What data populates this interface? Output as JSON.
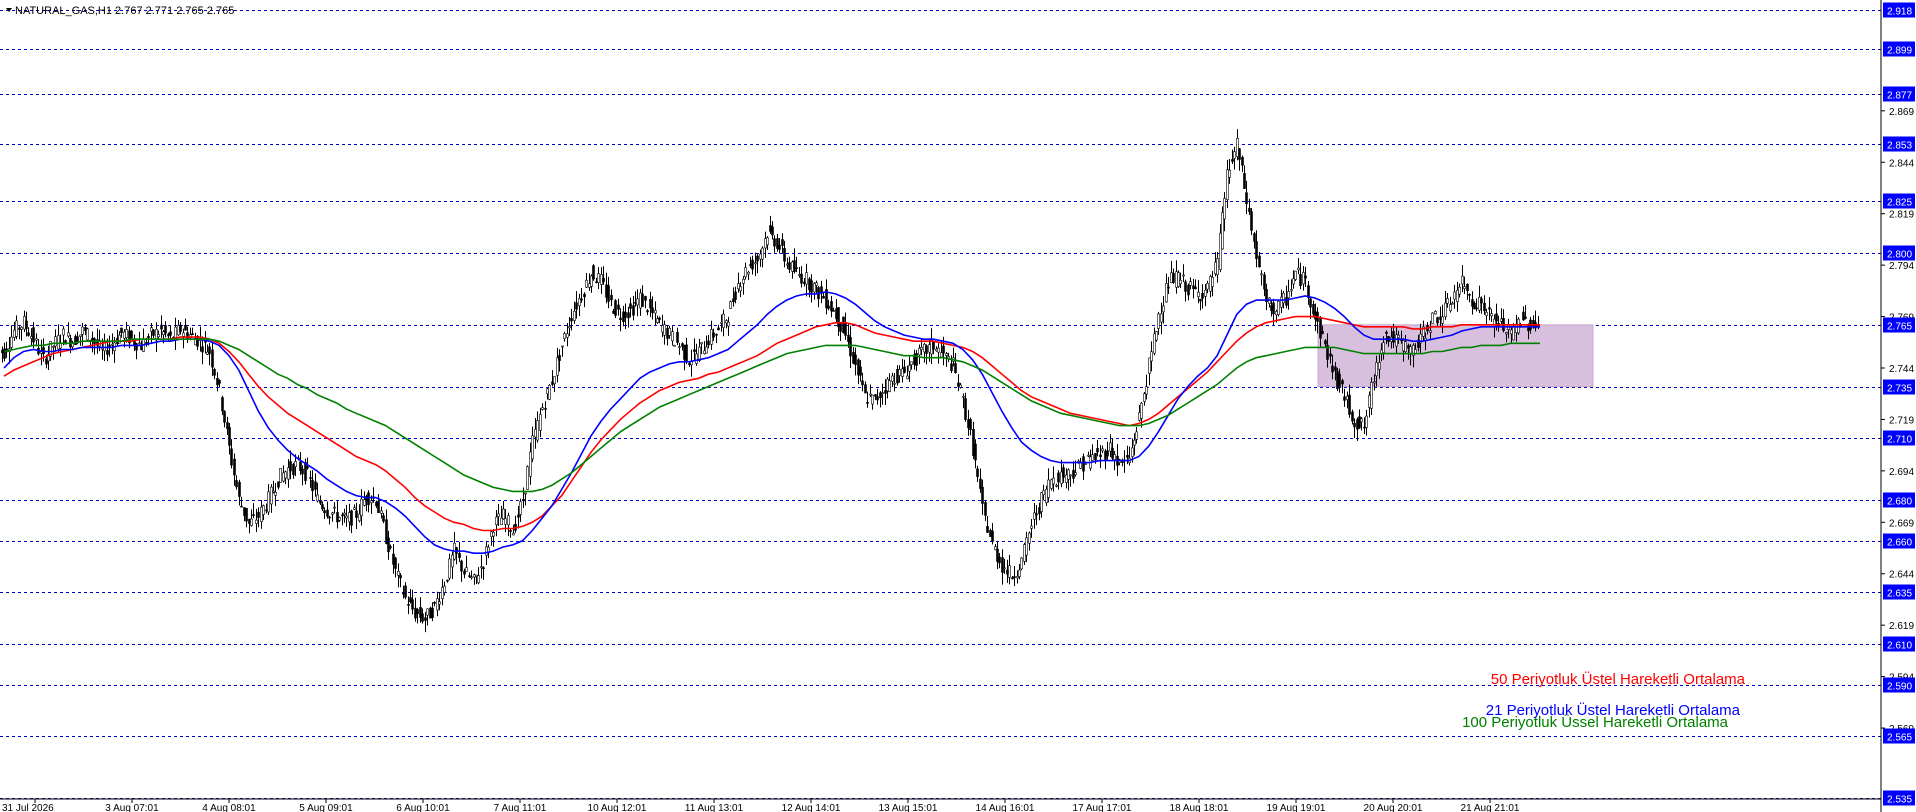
{
  "symbol_line": "NATURAL_GAS,H1  2.767 2.771 2.765 2.765",
  "legend": [
    {
      "text": "50 Periyotluk Üstel Hareketli Ortalama",
      "color": "#ff0000"
    },
    {
      "text": "21 Periyotluk Üstel Hareketli Ortalama",
      "color": "#0000ff"
    },
    {
      "text": "100 Periyotluk Üssel Hareketli Ortalama",
      "color": "#008000"
    }
  ],
  "colors": {
    "grid_line": "#0000cc",
    "candle": "#000000",
    "zone": "#d8bfdd",
    "label_bg": "#0000ff"
  },
  "chart_data": {
    "type": "line",
    "title": "NATURAL_GAS,H1",
    "ylim": [
      2.535,
      2.918
    ],
    "y_ticks": [
      "2.869",
      "2.844",
      "2.819",
      "2.794",
      "2.769",
      "2.744",
      "2.719",
      "2.694",
      "2.669",
      "2.644",
      "2.619",
      "2.594",
      "2.569"
    ],
    "horizontal_levels": [
      "2.918",
      "2.899",
      "2.877",
      "2.853",
      "2.825",
      "2.800",
      "2.765",
      "2.735",
      "2.710",
      "2.680",
      "2.660",
      "2.635",
      "2.610",
      "2.590",
      "2.565",
      "2.535"
    ],
    "x_labels": [
      "31 Jul 2026",
      "3 Aug 07:01",
      "4 Aug 08:01",
      "5 Aug 09:01",
      "6 Aug 10:01",
      "7 Aug 11:01",
      "10 Aug 12:01",
      "11 Aug 13:01",
      "12 Aug 14:01",
      "13 Aug 15:01",
      "14 Aug 16:01",
      "17 Aug 17:01",
      "18 Aug 18:01",
      "19 Aug 19:01",
      "20 Aug 20:01",
      "21 Aug 21:01"
    ],
    "zone": {
      "from_label": "20 Aug 20:01",
      "to_label": "21 Aug 21:01",
      "top": 2.765,
      "bottom": 2.735
    },
    "price": [
      2.752,
      2.762,
      2.766,
      2.758,
      2.748,
      2.755,
      2.76,
      2.757,
      2.762,
      2.758,
      2.752,
      2.756,
      2.761,
      2.758,
      2.755,
      2.76,
      2.762,
      2.758,
      2.763,
      2.76,
      2.757,
      2.752,
      2.733,
      2.705,
      2.68,
      2.668,
      2.672,
      2.68,
      2.69,
      2.695,
      2.697,
      2.692,
      2.68,
      2.675,
      2.672,
      2.67,
      2.673,
      2.682,
      2.68,
      2.662,
      2.645,
      2.632,
      2.625,
      2.622,
      2.628,
      2.64,
      2.655,
      2.645,
      2.64,
      2.65,
      2.668,
      2.672,
      2.665,
      2.68,
      2.708,
      2.725,
      2.738,
      2.755,
      2.77,
      2.78,
      2.79,
      2.786,
      2.775,
      2.77,
      2.772,
      2.778,
      2.772,
      2.765,
      2.76,
      2.755,
      2.748,
      2.752,
      2.758,
      2.763,
      2.77,
      2.785,
      2.793,
      2.797,
      2.81,
      2.805,
      2.795,
      2.79,
      2.787,
      2.782,
      2.777,
      2.77,
      2.76,
      2.745,
      2.73,
      2.728,
      2.735,
      2.74,
      2.742,
      2.748,
      2.752,
      2.755,
      2.75,
      2.745,
      2.728,
      2.705,
      2.675,
      2.658,
      2.648,
      2.643,
      2.65,
      2.668,
      2.68,
      2.69,
      2.692,
      2.693,
      2.697,
      2.7,
      2.702,
      2.705,
      2.697,
      2.7,
      2.72,
      2.745,
      2.77,
      2.786,
      2.788,
      2.783,
      2.78,
      2.782,
      2.795,
      2.838,
      2.852,
      2.825,
      2.798,
      2.775,
      2.772,
      2.778,
      2.79,
      2.786,
      2.768,
      2.755,
      2.74,
      2.73,
      2.718,
      2.715,
      2.74,
      2.76,
      2.758,
      2.755,
      2.752,
      2.76,
      2.768,
      2.77,
      2.778,
      2.785,
      2.777,
      2.775,
      2.768,
      2.765,
      2.76,
      2.768,
      2.765,
      2.765
    ],
    "series": [
      {
        "name": "50 Periyotluk Üstel Hareketli Ortalama",
        "color": "#ff0000",
        "values": [
          2.74,
          2.743,
          2.745,
          2.747,
          2.749,
          2.751,
          2.752,
          2.753,
          2.754,
          2.755,
          2.756,
          2.757,
          2.757,
          2.757,
          2.758,
          2.758,
          2.758,
          2.758,
          2.759,
          2.759,
          2.759,
          2.758,
          2.756,
          2.752,
          2.747,
          2.741,
          2.735,
          2.73,
          2.726,
          2.722,
          2.719,
          2.716,
          2.713,
          2.71,
          2.707,
          2.704,
          2.701,
          2.699,
          2.697,
          2.694,
          2.69,
          2.686,
          2.681,
          2.677,
          2.674,
          2.671,
          2.669,
          2.668,
          2.666,
          2.665,
          2.665,
          2.666,
          2.666,
          2.667,
          2.669,
          2.672,
          2.677,
          2.682,
          2.689,
          2.696,
          2.703,
          2.709,
          2.714,
          2.719,
          2.723,
          2.727,
          2.73,
          2.733,
          2.735,
          2.737,
          2.738,
          2.739,
          2.741,
          2.742,
          2.744,
          2.746,
          2.748,
          2.75,
          2.753,
          2.756,
          2.758,
          2.76,
          2.762,
          2.764,
          2.765,
          2.766,
          2.766,
          2.765,
          2.763,
          2.761,
          2.76,
          2.759,
          2.758,
          2.757,
          2.757,
          2.757,
          2.756,
          2.755,
          2.754,
          2.752,
          2.749,
          2.745,
          2.741,
          2.737,
          2.733,
          2.73,
          2.728,
          2.726,
          2.724,
          2.722,
          2.721,
          2.72,
          2.719,
          2.718,
          2.717,
          2.716,
          2.717,
          2.719,
          2.722,
          2.726,
          2.73,
          2.734,
          2.738,
          2.742,
          2.747,
          2.752,
          2.757,
          2.761,
          2.764,
          2.766,
          2.767,
          2.768,
          2.769,
          2.769,
          2.769,
          2.768,
          2.767,
          2.766,
          2.765,
          2.764,
          2.764,
          2.764,
          2.764,
          2.764,
          2.763,
          2.763,
          2.764,
          2.764,
          2.764,
          2.765,
          2.765,
          2.765,
          2.765,
          2.765,
          2.765,
          2.765,
          2.765,
          2.765
        ]
      },
      {
        "name": "21 Periyotluk Üstel Hareketli Ortalama",
        "color": "#0000ff",
        "values": [
          2.744,
          2.749,
          2.752,
          2.753,
          2.752,
          2.752,
          2.753,
          2.753,
          2.754,
          2.754,
          2.754,
          2.754,
          2.755,
          2.755,
          2.755,
          2.756,
          2.757,
          2.757,
          2.758,
          2.758,
          2.758,
          2.757,
          2.755,
          2.75,
          2.743,
          2.733,
          2.723,
          2.715,
          2.709,
          2.704,
          2.7,
          2.697,
          2.694,
          2.69,
          2.687,
          2.684,
          2.682,
          2.681,
          2.681,
          2.679,
          2.676,
          2.672,
          2.667,
          2.662,
          2.658,
          2.656,
          2.655,
          2.655,
          2.654,
          2.654,
          2.655,
          2.657,
          2.658,
          2.66,
          2.665,
          2.671,
          2.677,
          2.685,
          2.693,
          2.702,
          2.711,
          2.718,
          2.724,
          2.729,
          2.734,
          2.739,
          2.742,
          2.744,
          2.746,
          2.747,
          2.747,
          2.748,
          2.749,
          2.751,
          2.753,
          2.757,
          2.761,
          2.765,
          2.77,
          2.774,
          2.777,
          2.779,
          2.78,
          2.78,
          2.781,
          2.78,
          2.778,
          2.775,
          2.771,
          2.767,
          2.764,
          2.762,
          2.76,
          2.759,
          2.758,
          2.758,
          2.757,
          2.756,
          2.753,
          2.748,
          2.741,
          2.732,
          2.723,
          2.715,
          2.708,
          2.704,
          2.701,
          2.699,
          2.698,
          2.698,
          2.698,
          2.698,
          2.699,
          2.699,
          2.699,
          2.699,
          2.701,
          2.706,
          2.713,
          2.721,
          2.729,
          2.735,
          2.74,
          2.744,
          2.75,
          2.76,
          2.77,
          2.775,
          2.777,
          2.777,
          2.777,
          2.777,
          2.778,
          2.779,
          2.778,
          2.776,
          2.773,
          2.769,
          2.764,
          2.76,
          2.758,
          2.758,
          2.758,
          2.758,
          2.757,
          2.757,
          2.758,
          2.759,
          2.76,
          2.762,
          2.763,
          2.764,
          2.764,
          2.764,
          2.764,
          2.764,
          2.764,
          2.764
        ]
      },
      {
        "name": "100 Periyotluk Üssel Hareketli Ortalama",
        "color": "#008000",
        "values": [
          2.752,
          2.753,
          2.754,
          2.755,
          2.755,
          2.756,
          2.756,
          2.756,
          2.757,
          2.757,
          2.757,
          2.757,
          2.757,
          2.758,
          2.758,
          2.758,
          2.758,
          2.758,
          2.758,
          2.758,
          2.758,
          2.758,
          2.757,
          2.755,
          2.753,
          2.75,
          2.747,
          2.744,
          2.741,
          2.739,
          2.736,
          2.734,
          2.731,
          2.729,
          2.727,
          2.724,
          2.722,
          2.72,
          2.718,
          2.716,
          2.713,
          2.71,
          2.707,
          2.704,
          2.701,
          2.698,
          2.695,
          2.692,
          2.69,
          2.688,
          2.686,
          2.685,
          2.684,
          2.684,
          2.684,
          2.685,
          2.687,
          2.69,
          2.693,
          2.697,
          2.701,
          2.705,
          2.709,
          2.713,
          2.716,
          2.719,
          2.722,
          2.725,
          2.727,
          2.729,
          2.731,
          2.733,
          2.735,
          2.737,
          2.739,
          2.741,
          2.743,
          2.745,
          2.747,
          2.749,
          2.751,
          2.752,
          2.753,
          2.754,
          2.755,
          2.755,
          2.755,
          2.755,
          2.754,
          2.753,
          2.752,
          2.751,
          2.75,
          2.75,
          2.749,
          2.749,
          2.749,
          2.748,
          2.747,
          2.745,
          2.743,
          2.74,
          2.737,
          2.734,
          2.731,
          2.728,
          2.726,
          2.724,
          2.722,
          2.721,
          2.72,
          2.719,
          2.718,
          2.717,
          2.716,
          2.716,
          2.716,
          2.717,
          2.719,
          2.721,
          2.724,
          2.727,
          2.73,
          2.733,
          2.736,
          2.74,
          2.744,
          2.747,
          2.749,
          2.75,
          2.751,
          2.752,
          2.753,
          2.754,
          2.754,
          2.754,
          2.754,
          2.753,
          2.752,
          2.751,
          2.751,
          2.751,
          2.751,
          2.751,
          2.751,
          2.751,
          2.752,
          2.752,
          2.753,
          2.754,
          2.754,
          2.755,
          2.755,
          2.755,
          2.756,
          2.756,
          2.756,
          2.756
        ]
      }
    ]
  }
}
